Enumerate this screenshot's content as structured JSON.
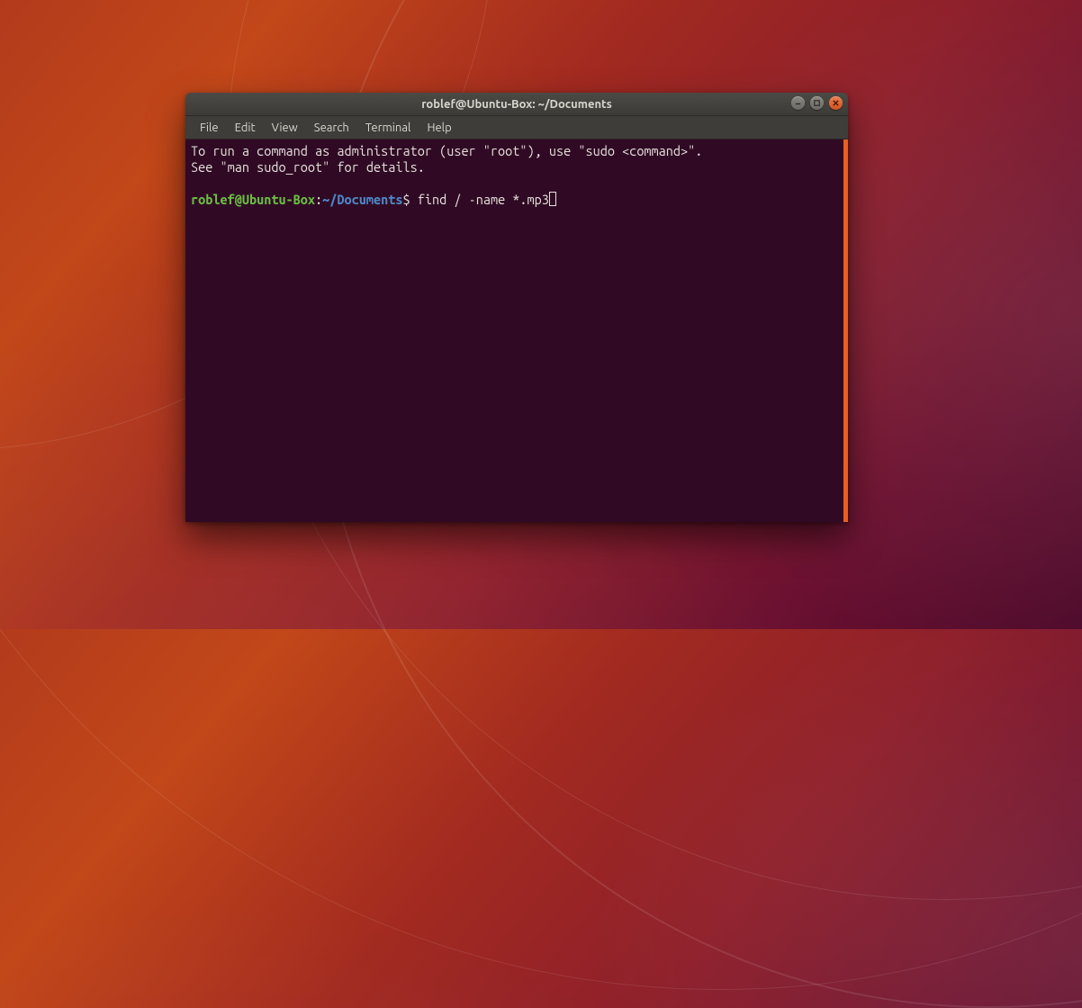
{
  "window": {
    "title": "roblef@Ubuntu-Box: ~/Documents"
  },
  "menubar": {
    "items": [
      "File",
      "Edit",
      "View",
      "Search",
      "Terminal",
      "Help"
    ]
  },
  "terminal": {
    "line1": "To run a command as administrator (user \"root\"), use \"sudo <command>\".",
    "line2": "See \"man sudo_root\" for details.",
    "prompt": {
      "user_host": "roblef@Ubuntu-Box",
      "separator": ":",
      "path": "~/Documents",
      "symbol": "$"
    },
    "command": "find / -name *.mp3"
  },
  "colors": {
    "terminal_bg": "#300a24",
    "prompt_user": "#6bbd45",
    "prompt_path": "#4e88c7",
    "scrollbar": "#e65f24"
  }
}
